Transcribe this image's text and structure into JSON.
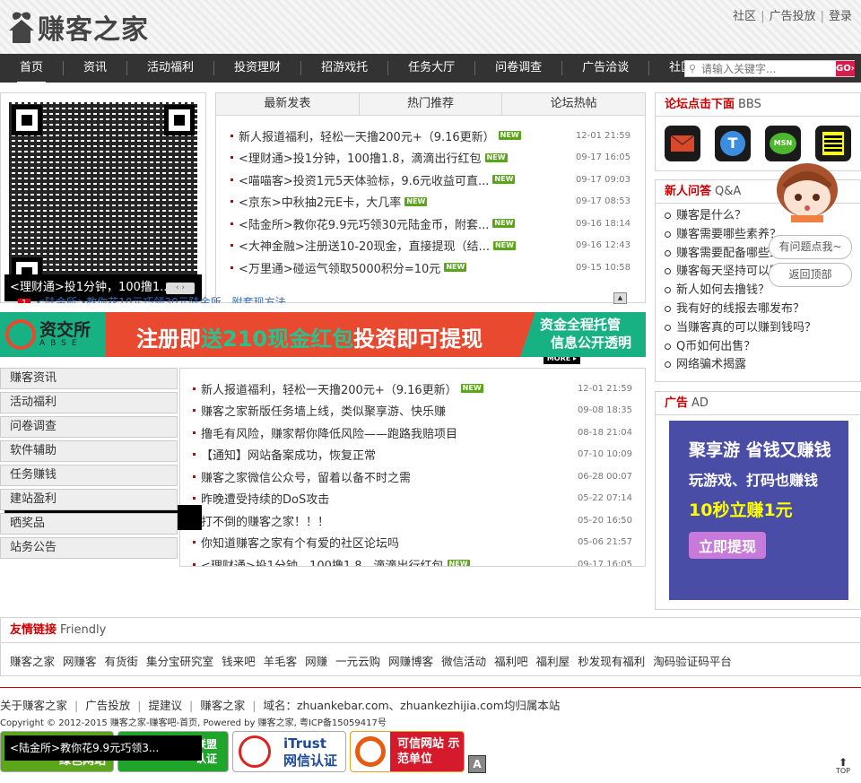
{
  "header": {
    "logo_text": "赚客之家",
    "top_links": [
      "社区",
      "广告投放",
      "登录"
    ]
  },
  "nav": {
    "items": [
      "首页",
      "资讯",
      "活动福利",
      "投资理财",
      "招游戏托",
      "任务大厅",
      "问卷调查",
      "广告洽谈",
      "社区"
    ],
    "active": "首页",
    "search_placeholder": "请输入关键字...",
    "search_button": "GO›"
  },
  "qr": {
    "caption": "<理财通>投1分钟，100撸1....",
    "arrows": "‹ ›"
  },
  "tabs": {
    "labels": [
      "最新发表",
      "热门推荐",
      "论坛热帖"
    ],
    "items": [
      {
        "title": "新人报道福利，轻松一天撸200元+（9.16更新）",
        "new": "NEW",
        "date": "12-01 21:59"
      },
      {
        "title": "<理财通>投1分钟，100撸1.8，滴滴出行红包",
        "new": "NEW",
        "date": "09-17 16:05"
      },
      {
        "title": "<喵喵客>投资1元5天体验标，9.6元收益可直...",
        "new": "NEW",
        "date": "09-17 09:03"
      },
      {
        "title": "<京东>中秋抽2元E卡，大几率",
        "new": "NEW",
        "date": "09-17 08:53"
      },
      {
        "title": "<陆金所>教你花9.9元巧领30元陆金币，附套...",
        "new": "NEW",
        "date": "09-16 18:14"
      },
      {
        "title": "<大神金融>注册送10-20现金，直接提现（结...",
        "new": "NEW",
        "date": "09-16 12:43"
      },
      {
        "title": "<万里通>碰运气领取5000积分=10元",
        "new": "NEW",
        "date": "09-15 10:58"
      }
    ],
    "more": "MORE ▸",
    "ticker_num": "1",
    "ticker_text": "<陆金所>教你花10元巧领30元陆金所，附套现方法"
  },
  "banner": {
    "brand": "资交所",
    "brand_en": "ABSE",
    "text_a": "注册即",
    "text_b": "送210现金红包",
    "text_c": "投资即可提现",
    "right_1": "资金全程托管",
    "right_2": "信息公开透明"
  },
  "categories": [
    "赚客资讯",
    "活动福利",
    "问卷调查",
    "软件辅助",
    "任务赚钱",
    "建站盈利",
    "晒奖品",
    "站务公告"
  ],
  "news": [
    {
      "title": "新人报道福利，轻松一天撸200元+（9.16更新）",
      "new": "NEW",
      "date": "12-01 21:59"
    },
    {
      "title": "赚客之家新版任务墙上线，类似聚享游、快乐赚",
      "date": "09-08 18:35"
    },
    {
      "title": "撸毛有风险，赚家帮你降低风险——跑路我赔项目",
      "date": "08-18 21:04"
    },
    {
      "title": "【通知】网站备案成功，恢复正常",
      "date": "07-10 10:09"
    },
    {
      "title": "赚客之家微信公众号，留着以备不时之需",
      "date": "06-28 00:07"
    },
    {
      "title": "昨晚遭受持续的DoS攻击",
      "date": "05-22 07:14"
    },
    {
      "title": "打不倒的赚客之家！！！",
      "date": "05-20 16:50"
    },
    {
      "title": "你知道赚客之家有个有爱的社区论坛吗",
      "date": "05-06 21:57"
    },
    {
      "title": "<理财通>投1分钟，100撸1.8，滴滴出行红包",
      "new": "NEW",
      "date": "09-17 16:05"
    }
  ],
  "bbs": {
    "title": "论坛点击下面",
    "sub": "BBS",
    "icons": [
      "mail-icon",
      "tencent-weibo-icon",
      "msn-icon",
      "notes-icon"
    ],
    "msn_label": "MSN"
  },
  "qa": {
    "title": "新人问答",
    "sub": "Q&A",
    "items": [
      "赚客是什么？",
      "赚客需要哪些素养？",
      "赚客需要配备哪些工具？",
      "赚客每天坚持可以赚多少？",
      "新人如何去撸钱？",
      "我有好的线报去哪发布？",
      "当赚客真的可以赚到钱吗？",
      "Q币如何出售？",
      "网络骗术揭露"
    ]
  },
  "ad": {
    "title": "广告",
    "sub": "AD",
    "line1": "聚享游 省钱又赚钱",
    "line2": "玩游戏、打码也赚钱",
    "line3": "10秒立赚1元",
    "button": "立即提现"
  },
  "friendly": {
    "title": "友情链接",
    "sub": "Friendly",
    "links": [
      "赚客之家",
      "网赚客",
      "有货街",
      "集分宝研究室",
      "钱来吧",
      "羊毛客",
      "网赚",
      "一元云购",
      "网赚博客",
      "微信活动",
      "福利吧",
      "福利屋",
      "秒发现有福利",
      "淘码验证码平台"
    ]
  },
  "footer": {
    "links": [
      "关于赚客之家",
      "广告投放",
      "提建议",
      "赚客之家",
      "域名：zhuankebar.com、zhuankezhijia.com均归属本站"
    ],
    "copyright": "Copyright © 2012-2015 赚客之家-赚客吧-首页,  Powered by 赚客之家,  粤ICP备15059417号",
    "badges": [
      "绿色网站",
      "联盟认证",
      "iTrust 网信认证",
      "可信网站 示范单位"
    ]
  },
  "float": {
    "ask": "有问题点我~",
    "back_top": "返回顶部",
    "popup": "<陆金所>教你花9.9元巧领3...",
    "top": "TOP"
  },
  "colors": {
    "accent": "#cc0000",
    "nav_bg": "#333333",
    "go_button": "#d81e4f"
  }
}
